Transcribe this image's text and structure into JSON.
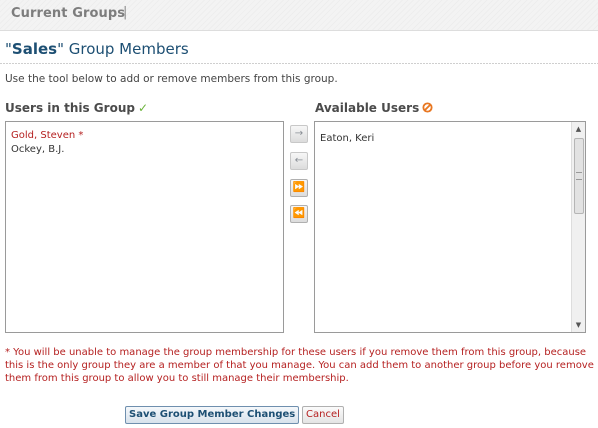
{
  "header": {
    "title": "Current Groups",
    "separator": "|"
  },
  "group": {
    "name_prefix": "\"",
    "name": "Sales",
    "name_suffix": "\"",
    "heading_rest": " Group Members"
  },
  "intro": "Use the tool below to add or remove members from this group.",
  "columns": {
    "members_label": "Users in this Group",
    "available_label": "Available Users"
  },
  "members": [
    {
      "name": "Gold, Steven *",
      "flagged": true
    },
    {
      "name": "Ockey, B.J.",
      "flagged": false
    }
  ],
  "available": [
    {
      "name": "Eaton, Keri"
    }
  ],
  "move_buttons": {
    "add": "→",
    "remove": "←",
    "add_all": "⏩",
    "remove_all": "⏪"
  },
  "scrollbar": {
    "up": "▲",
    "down": "▼"
  },
  "warning": "* You will be unable to manage the group membership for these users if you remove them from this group, because this is the only group they are a member of that you manage. You can add them to another group before you remove them from this group to allow you to still manage their membership.",
  "actions": {
    "save_label": "Save Group Member Changes",
    "cancel_label": "Cancel"
  },
  "colors": {
    "heading": "#1d4f73",
    "warning": "#b52121",
    "check": "#6bb33a",
    "forbid": "#e87722"
  },
  "icons": {
    "members_status": "check-icon",
    "available_status": "forbid-icon"
  }
}
